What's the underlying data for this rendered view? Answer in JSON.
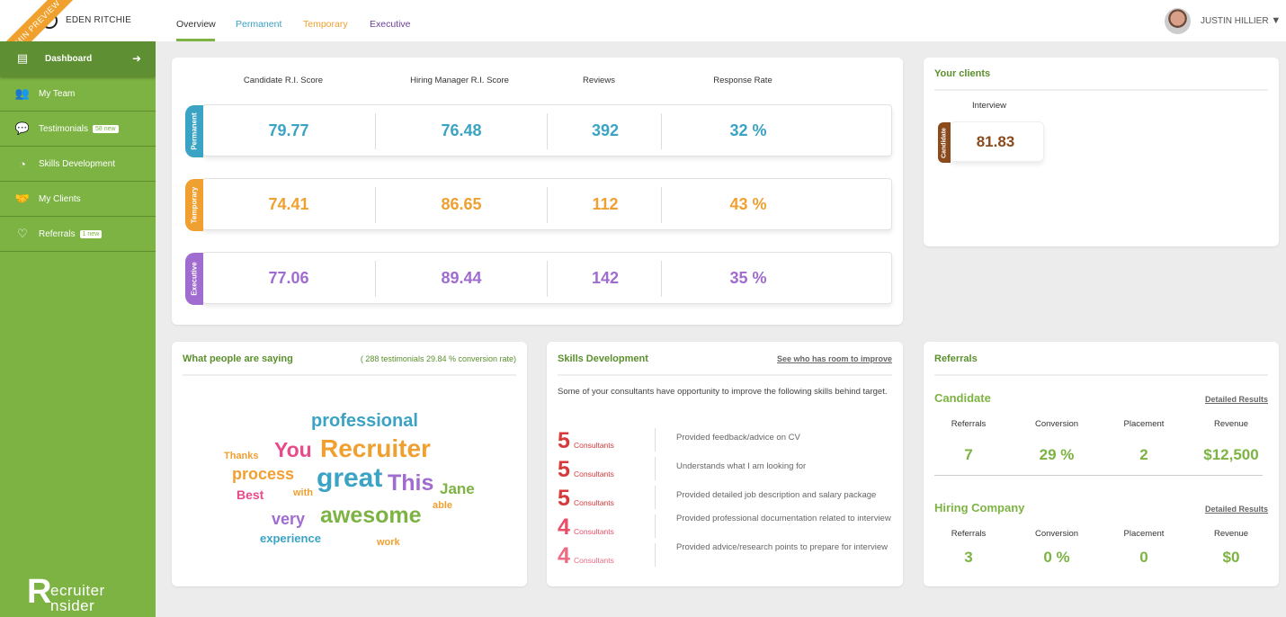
{
  "sidebar": {
    "user_name": "EDEN RITCHIE",
    "ribbon": "ADMIN PREVIEW",
    "items": [
      {
        "label": "Dashboard",
        "icon": "newspaper-icon",
        "active": true
      },
      {
        "label": "My Team",
        "icon": "users-icon"
      },
      {
        "label": "Testimonials",
        "icon": "speech-bubble-icon",
        "badge": "58 new"
      },
      {
        "label": "Skills Development",
        "icon": "chart-circle-icon"
      },
      {
        "label": "My Clients",
        "icon": "handshake-icon"
      },
      {
        "label": "Referrals",
        "icon": "heart-icon",
        "badge": "1 new"
      }
    ],
    "brand": {
      "initial1": "R",
      "line1": "ecruiter",
      "line2": "nsider"
    }
  },
  "topbar": {
    "tabs": [
      {
        "label": "Overview",
        "color": "#333333",
        "active": true
      },
      {
        "label": "Permanent",
        "color": "#3a9fc0"
      },
      {
        "label": "Temporary",
        "color": "#f0a030"
      },
      {
        "label": "Executive",
        "color": "#6a3f9a"
      }
    ],
    "user": "JUSTIN HILLIER",
    "dropdown_glyph": "▼"
  },
  "scores": {
    "headers": [
      "Candidate R.I. Score",
      "Hiring Manager R.I. Score",
      "Reviews",
      "Response Rate"
    ],
    "rows": [
      {
        "label": "Permanent",
        "color": "#3ba3c4",
        "values": [
          "79.77",
          "76.48",
          "392",
          "32 %"
        ]
      },
      {
        "label": "Temporary",
        "color": "#f0a030",
        "values": [
          "74.41",
          "86.65",
          "112",
          "43 %"
        ]
      },
      {
        "label": "Executive",
        "color": "#a06cd0",
        "values": [
          "77.06",
          "89.44",
          "142",
          "35 %"
        ]
      }
    ]
  },
  "clients": {
    "title": "Your clients",
    "header": "Interview",
    "tag": "Candidate",
    "tag_color": "#8b4a1c",
    "value": "81.83"
  },
  "testimonials": {
    "title": "What people are saying",
    "summary": "( 288 testimonials 29.84 % conversion rate)",
    "words": [
      {
        "text": "professional",
        "color": "#3ba3c4"
      },
      {
        "text": "You",
        "color": "#e84a8a"
      },
      {
        "text": "Recruiter",
        "color": "#f0a030"
      },
      {
        "text": "Thanks",
        "color": "#f0a030"
      },
      {
        "text": "process",
        "color": "#f0a030"
      },
      {
        "text": "great",
        "color": "#3ba3c4"
      },
      {
        "text": "This",
        "color": "#a06cd0"
      },
      {
        "text": "Jane",
        "color": "#7cb342"
      },
      {
        "text": "Best",
        "color": "#e84a8a"
      },
      {
        "text": "with",
        "color": "#f0a030"
      },
      {
        "text": "able",
        "color": "#f0a030"
      },
      {
        "text": "very",
        "color": "#a06cd0"
      },
      {
        "text": "awesome",
        "color": "#7cb342"
      },
      {
        "text": "experience",
        "color": "#3ba3c4"
      },
      {
        "text": "work",
        "color": "#f0a030"
      }
    ]
  },
  "skills": {
    "title": "Skills Development",
    "link": "See who has room to improve",
    "intro": "Some of your consultants have opportunity to improve the following skills behind target.",
    "unit": "Consultants",
    "items": [
      {
        "count": "5",
        "color": "#d63a3a",
        "desc": "Provided feedback/advice on CV"
      },
      {
        "count": "5",
        "color": "#d63a3a",
        "desc": "Understands what I am looking for"
      },
      {
        "count": "5",
        "color": "#d63a3a",
        "desc": "Provided detailed job description and salary package"
      },
      {
        "count": "4",
        "color": "#e8506a",
        "desc": "Provided professional documentation related to interview"
      },
      {
        "count": "4",
        "color": "#ec6c84",
        "desc": "Provided advice/research points to prepare for interview"
      }
    ]
  },
  "referrals": {
    "title": "Referrals",
    "sections": [
      {
        "title": "Candidate",
        "link": "Detailed Results",
        "labels": [
          "Referrals",
          "Conversion",
          "Placement",
          "Revenue"
        ],
        "values": [
          "7",
          "29 %",
          "2",
          "$12,500"
        ]
      },
      {
        "title": "Hiring Company",
        "link": "Detailed Results",
        "labels": [
          "Referrals",
          "Conversion",
          "Placement",
          "Revenue"
        ],
        "values": [
          "3",
          "0 %",
          "0",
          "$0"
        ]
      }
    ]
  }
}
